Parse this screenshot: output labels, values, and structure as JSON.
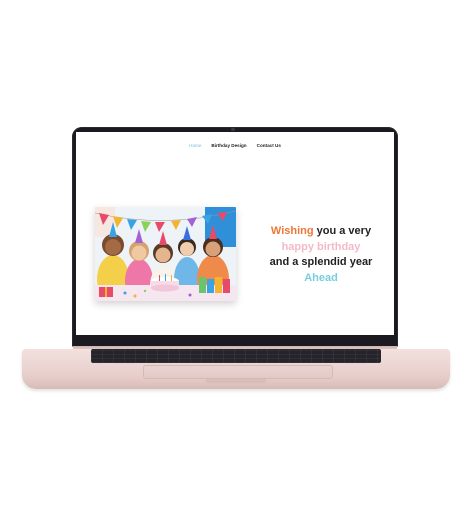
{
  "nav": {
    "items": [
      "Home",
      "Birthday Design",
      "Contact Us"
    ],
    "active": "Home"
  },
  "hero": {
    "image_alt": "children celebrating birthday with cake and party hats",
    "headline": {
      "line1_accent": "Wishing",
      "line1_rest": " you a very",
      "line2": "happy birthday",
      "line3": "and a splendid year",
      "line4": "Ahead"
    }
  },
  "colors": {
    "accent_orange": "#ee7737",
    "accent_pink": "#f4b9c9",
    "accent_blue": "#76cde0",
    "nav_active": "#6fc4de",
    "text_dark": "#222222",
    "laptop_body": "#e7cdca",
    "bezel": "#1b1a20"
  }
}
